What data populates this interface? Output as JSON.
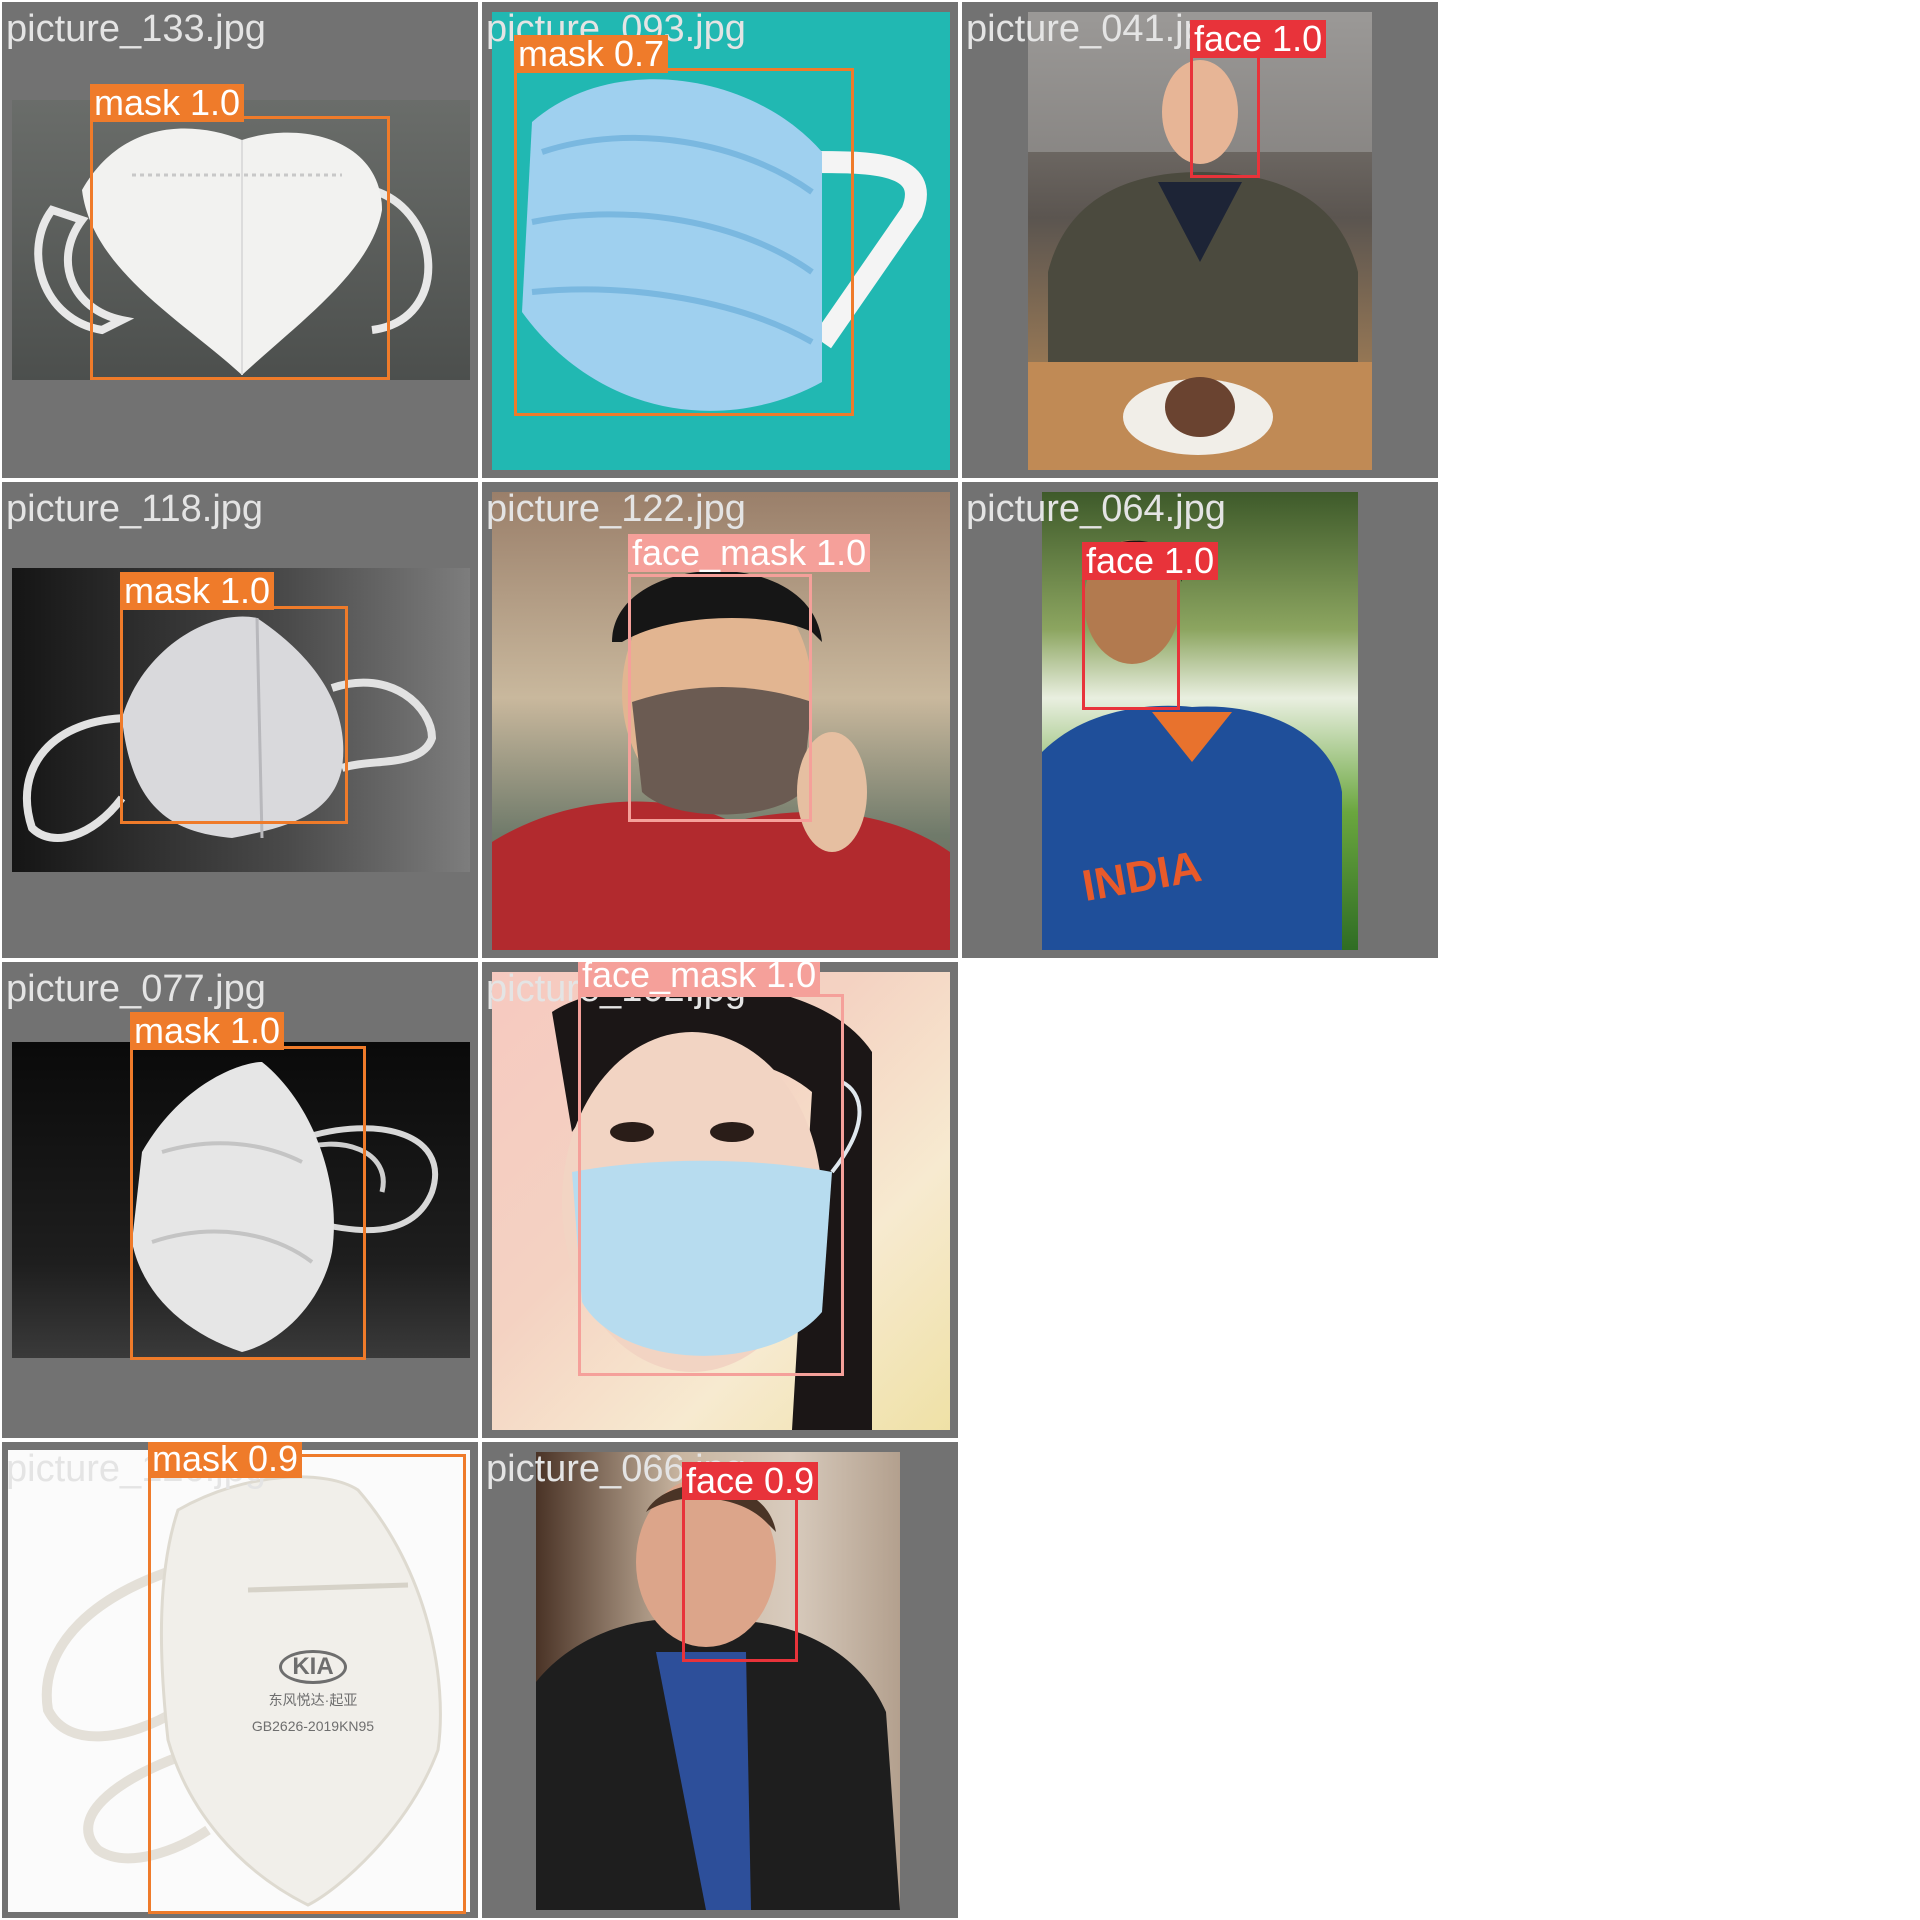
{
  "colors": {
    "tile_bg": "#727272",
    "mask": "#ef7b2a",
    "face": "#e8333a",
    "face_mask": "#f5a09a"
  },
  "tiles": [
    {
      "filename": "picture_133.jpg",
      "detections": [
        {
          "label": "mask 1.0",
          "class": "mask"
        }
      ]
    },
    {
      "filename": "picture_093.jpg",
      "detections": [
        {
          "label": "mask 0.7",
          "class": "mask"
        }
      ]
    },
    {
      "filename": "picture_041.jpg",
      "detections": [
        {
          "label": "face 1.0",
          "class": "face"
        }
      ]
    },
    {
      "filename": "picture_118.jpg",
      "detections": [
        {
          "label": "mask 1.0",
          "class": "mask"
        }
      ]
    },
    {
      "filename": "picture_122.jpg",
      "detections": [
        {
          "label": "face_mask 1.0",
          "class": "face_mask"
        }
      ]
    },
    {
      "filename": "picture_064.jpg",
      "detections": [
        {
          "label": "face 1.0",
          "class": "face"
        }
      ]
    },
    {
      "filename": "picture_077.jpg",
      "detections": [
        {
          "label": "mask 1.0",
          "class": "mask"
        }
      ]
    },
    {
      "filename": "picture_102.jpg",
      "detections": [
        {
          "label": "face_mask 1.0",
          "class": "face_mask"
        }
      ]
    },
    {
      "filename": "picture_126.jpg",
      "detections": [
        {
          "label": "mask 0.9",
          "class": "mask"
        }
      ]
    },
    {
      "filename": "picture_066.jpg",
      "detections": [
        {
          "label": "face 0.9",
          "class": "face"
        }
      ]
    }
  ],
  "shirt_text": "INDIA",
  "mask_print": {
    "brand": "KIA",
    "line1": "东风悦达·起亚",
    "line2": "GB2626-2019KN95"
  }
}
